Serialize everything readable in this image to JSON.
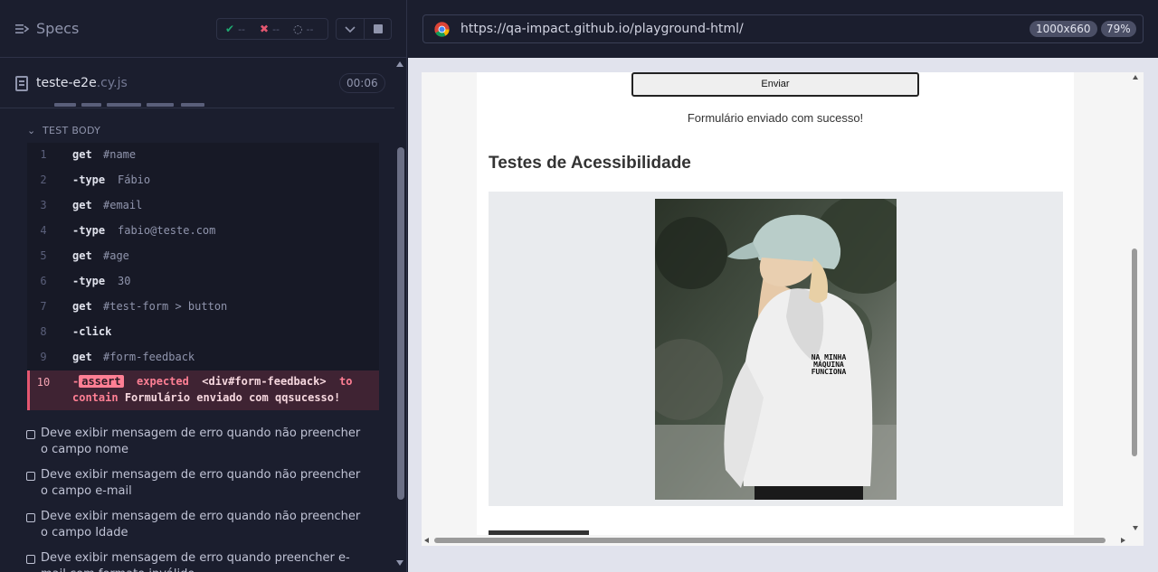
{
  "sidebar": {
    "title": "Specs",
    "stats": {
      "passed": "--",
      "failed": "--",
      "pending": "--"
    }
  },
  "spec": {
    "file_name": "teste-e2e",
    "file_ext": ".cy.js",
    "duration": "00:06",
    "section_label": "TEST BODY"
  },
  "commands": [
    {
      "num": "1",
      "name": "get",
      "arg": "#name"
    },
    {
      "num": "2",
      "name": "-type",
      "arg": "Fábio"
    },
    {
      "num": "3",
      "name": "get",
      "arg": "#email"
    },
    {
      "num": "4",
      "name": "-type",
      "arg": "fabio@teste.com"
    },
    {
      "num": "5",
      "name": "get",
      "arg": "#age"
    },
    {
      "num": "6",
      "name": "-type",
      "arg": "30"
    },
    {
      "num": "7",
      "name": "get",
      "arg": "#test-form > button"
    },
    {
      "num": "8",
      "name": "-click",
      "arg": ""
    },
    {
      "num": "9",
      "name": "get",
      "arg": "#form-feedback"
    }
  ],
  "failed_command": {
    "num": "10",
    "dash": "-",
    "badge": "assert",
    "expected": "expected",
    "subject": "<div#form-feedback>",
    "to": "to",
    "contain": "contain",
    "value": "Formulário enviado com qqsucesso!"
  },
  "tests": [
    "Deve exibir mensagem de erro quando não preencher o campo nome",
    "Deve exibir mensagem de erro quando não preencher o campo e-mail",
    "Deve exibir mensagem de erro quando não preencher o campo Idade",
    "Deve exibir mensagem de erro quando preencher e-mail com formato inválido"
  ],
  "browser": {
    "url": "https://qa-impact.github.io/playground-html/",
    "viewport": "1000x660",
    "zoom": "79%"
  },
  "aut": {
    "button_label": "Enviar",
    "feedback": "Formulário enviado com sucesso!",
    "section_title": "Testes de Acessibilidade",
    "hoodie_text": [
      "NA MINHA",
      "MÁQUINA",
      "FUNCIONA"
    ]
  },
  "colors": {
    "pass": "#1fa971",
    "fail": "#e45770",
    "panel_bg": "#1b1e2e"
  }
}
